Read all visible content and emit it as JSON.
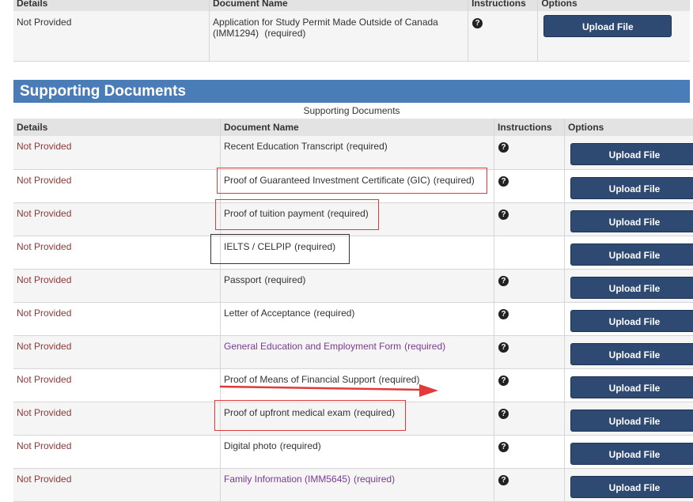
{
  "top_table": {
    "headers": {
      "details": "Details",
      "name": "Document Name",
      "instructions": "Instructions",
      "options": "Options"
    },
    "row": {
      "status": "Not Provided",
      "name_line1": "Application for Study Permit Made Outside of Canada",
      "name_line2": "(IMM1294)",
      "required": "(required)",
      "button": "Upload File"
    }
  },
  "section": {
    "title": "Supporting Documents",
    "caption": "Supporting Documents"
  },
  "table": {
    "headers": {
      "details": "Details",
      "name": "Document Name",
      "instructions": "Instructions",
      "options": "Options"
    },
    "rows": [
      {
        "status": "Not Provided",
        "name": "Recent Education Transcript",
        "required": "(required)",
        "button": "Upload File"
      },
      {
        "status": "Not Provided",
        "name": "Proof of Guaranteed Investment Certificate (GIC)",
        "required": "(required)",
        "button": "Upload File"
      },
      {
        "status": "Not Provided",
        "name": "Proof of tuition payment",
        "required": "(required)",
        "button": "Upload File"
      },
      {
        "status": "Not Provided",
        "name": "IELTS / CELPIP",
        "required": "(required)",
        "button": "Upload File"
      },
      {
        "status": "Not Provided",
        "name": "Passport",
        "required": "(required)",
        "button": "Upload File"
      },
      {
        "status": "Not Provided",
        "name": "Letter of Acceptance",
        "required": "(required)",
        "button": "Upload File"
      },
      {
        "status": "Not Provided",
        "name": "General Education and Employment Form",
        "required": "(required)",
        "button": "Upload File"
      },
      {
        "status": "Not Provided",
        "name": "Proof of Means of Financial Support",
        "required": "(required)",
        "button": "Upload File"
      },
      {
        "status": "Not Provided",
        "name": "Proof of upfront medical exam",
        "required": "(required)",
        "button": "Upload File"
      },
      {
        "status": "Not Provided",
        "name": "Digital photo",
        "required": "(required)",
        "button": "Upload File"
      },
      {
        "status": "Not Provided",
        "name": "Family Information (IMM5645)",
        "required": "(required)",
        "button": "Upload File"
      }
    ]
  },
  "icons": {
    "help": "help-question-icon"
  },
  "colors": {
    "section_bar": "#4a7cb8",
    "button": "#2f4a72",
    "status": "#8a3a3a",
    "link": "#7a3a92",
    "annotation": "#e03a3a"
  }
}
